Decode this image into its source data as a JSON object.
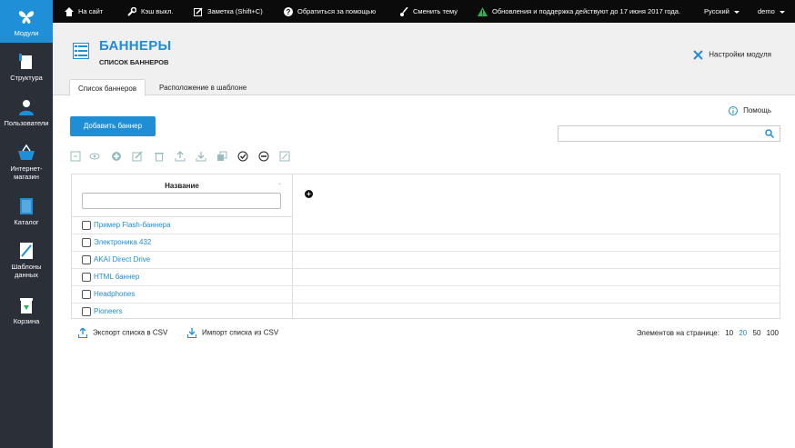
{
  "sidebar": {
    "items": [
      {
        "label": "Модули",
        "icon": "butterfly-icon"
      },
      {
        "label": "Структура",
        "icon": "structure-icon"
      },
      {
        "label": "Пользователи",
        "icon": "user-icon"
      },
      {
        "label": "Интернет-магазин",
        "icon": "basket-icon"
      },
      {
        "label": "Каталог",
        "icon": "book-icon"
      },
      {
        "label": "Шаблоны данных",
        "icon": "template-icon"
      },
      {
        "label": "Корзина",
        "icon": "trash-icon"
      }
    ]
  },
  "topbar": {
    "site": "На сайт",
    "cache": "Кэш выкл.",
    "note": "Заметка (Shift+C)",
    "support": "Обратиться за помощью",
    "theme": "Сменить тему",
    "updates": "Обновления и поддержка действуют до 17 июня 2017 года.",
    "language": "Русский",
    "user": "demo"
  },
  "header": {
    "title": "БАННЕРЫ",
    "subtitle": "СПИСОК БАННЕРОВ",
    "settings": "Настройки модуля",
    "tabs": [
      {
        "label": "Список баннеров",
        "active": true
      },
      {
        "label": "Расположение в шаблоне",
        "active": false
      }
    ]
  },
  "content": {
    "help": "Помощь",
    "add_button": "Добавить баннер",
    "search_placeholder": "",
    "column_name": "Название",
    "filter_placeholder": "",
    "rows": [
      {
        "name": "Пример Flash-баннера"
      },
      {
        "name": "Электроника 432"
      },
      {
        "name": "AKAI Direct Drive"
      },
      {
        "name": "HTML баннер"
      },
      {
        "name": "Headphones"
      },
      {
        "name": "Pioneers"
      }
    ],
    "export_csv": "Экспорт списка в CSV",
    "import_csv": "Импорт списка из CSV",
    "per_page_label": "Элементов на странице:",
    "per_page_options": [
      "10",
      "20",
      "50",
      "100"
    ],
    "per_page_selected": "20"
  },
  "colors": {
    "accent": "#1e8ed6",
    "sidebar_bg": "#2b2f38",
    "topbar_bg": "#0b0b0b",
    "header_bg": "#f0f0f0"
  }
}
